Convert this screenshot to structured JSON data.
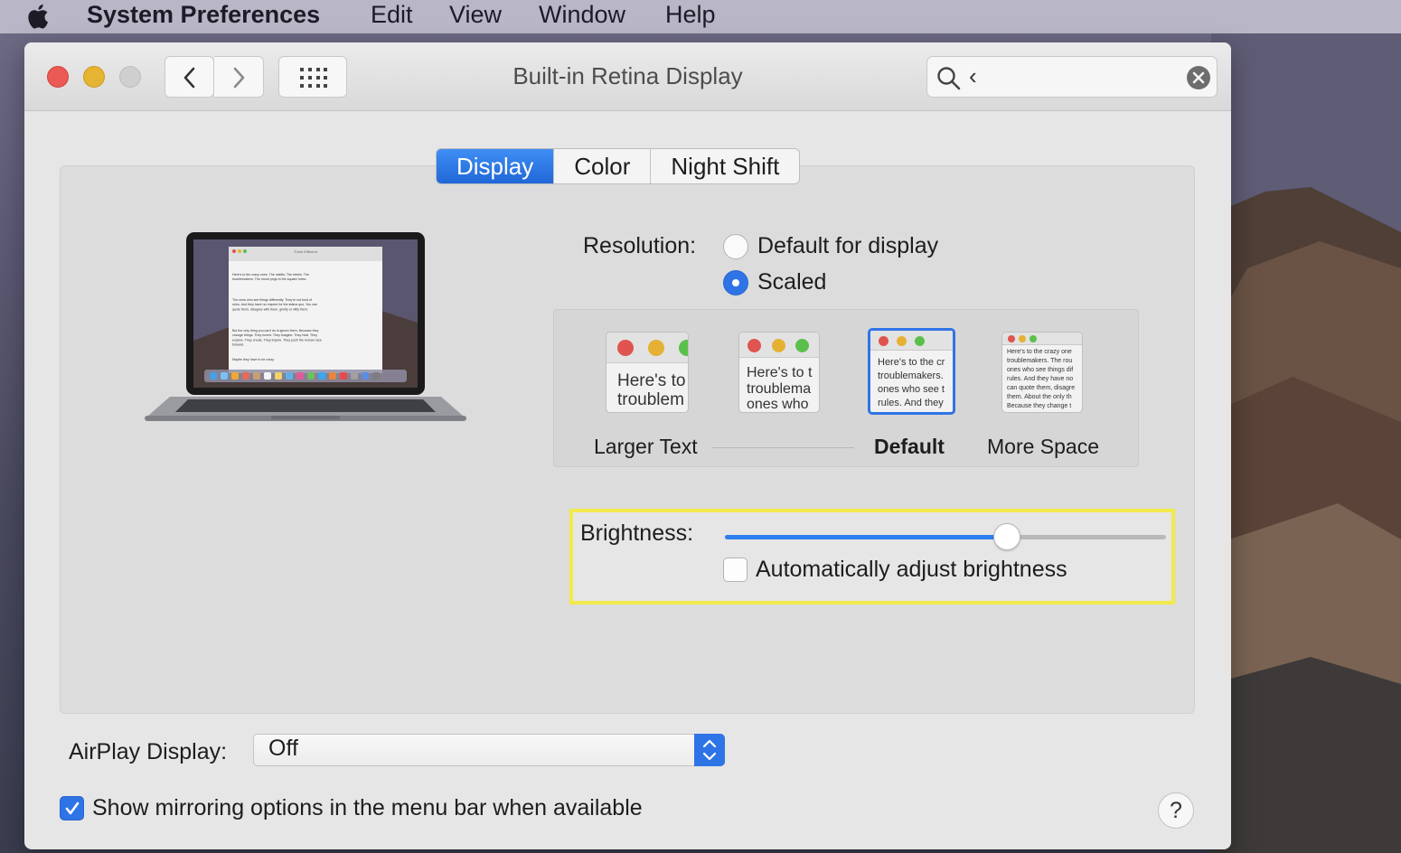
{
  "menubar": {
    "app_name": "System Preferences",
    "items": [
      "Edit",
      "View",
      "Window",
      "Help"
    ]
  },
  "window": {
    "title": "Built-in Retina Display",
    "search_value": "‹"
  },
  "tabs": [
    {
      "label": "Display",
      "active": true
    },
    {
      "label": "Color",
      "active": false
    },
    {
      "label": "Night Shift",
      "active": false
    }
  ],
  "resolution": {
    "label": "Resolution:",
    "options": [
      {
        "label": "Default for display",
        "selected": false
      },
      {
        "label": "Scaled",
        "selected": true
      }
    ]
  },
  "scaled": {
    "options": [
      {
        "label": "Larger Text",
        "preview": "Here's to\ntroublem",
        "selected": false
      },
      {
        "label": "",
        "preview": "Here's to t\ntroublema\nones who",
        "selected": false
      },
      {
        "label": "Default",
        "preview": "Here's to the cr\ntroublemakers.\nones who see t\nrules. And they",
        "selected": true
      },
      {
        "label": "More Space",
        "preview": "Here's to the crazy one\ntroublemakers. The rou\nones who see things dif\nrules. And they have no\ncan quote them, disagre\nthem. About the only th\nBecause they change t",
        "selected": false
      }
    ]
  },
  "brightness": {
    "label": "Brightness:",
    "level": 0.64,
    "auto_label": "Automatically adjust brightness",
    "auto_checked": false
  },
  "airplay": {
    "label": "AirPlay Display:",
    "value": "Off"
  },
  "mirroring": {
    "label": "Show mirroring options in the menu bar when available",
    "checked": true
  },
  "help_label": "?",
  "laptop_screen": {
    "doc_title": "Think Different",
    "paragraphs": [
      "Here's to the crazy ones. The misfits. The rebels. The troublemakers. The round pegs in the square holes.",
      "The ones who see things differently. They're not fond of rules. And they have no respect for the status quo. You can quote them, disagree with them, glorify or vilify them.",
      "But the only thing you can't do is ignore them. Because they change things. They invent. They imagine. They heal. They explore. They create. They inspire. They push the human race forward.",
      "Maybe they have to be crazy."
    ]
  },
  "colors": {
    "accent": "#2f74e6",
    "highlight": "#f2e94a"
  }
}
